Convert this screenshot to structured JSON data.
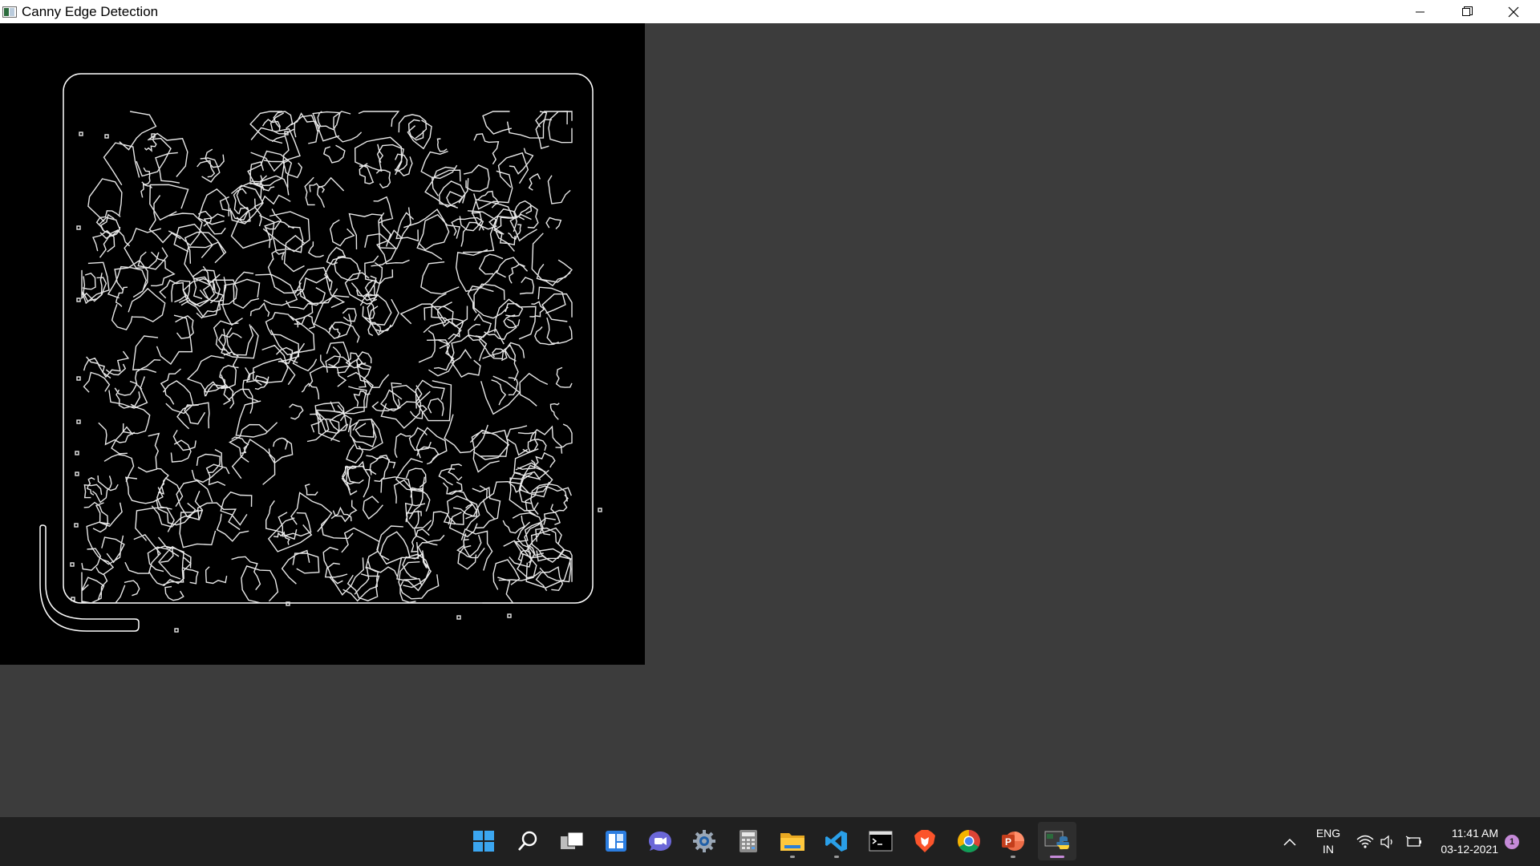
{
  "window": {
    "title": "Canny Edge Detection",
    "controls": {
      "minimize": "minimize-icon",
      "restore": "restore-icon",
      "close": "close-icon"
    }
  },
  "canvas": {
    "background": "#000000",
    "edge_color": "#ffffff"
  },
  "taskbar": {
    "pinned": [
      {
        "name": "start",
        "icon": "windows-start-icon"
      },
      {
        "name": "search",
        "icon": "search-icon"
      },
      {
        "name": "task-view",
        "icon": "task-view-icon"
      },
      {
        "name": "widgets",
        "icon": "widgets-icon"
      },
      {
        "name": "chat",
        "icon": "chat-icon"
      },
      {
        "name": "settings",
        "icon": "gear-icon"
      },
      {
        "name": "calculator",
        "icon": "calculator-icon"
      },
      {
        "name": "file-explorer",
        "icon": "folder-icon"
      },
      {
        "name": "vscode",
        "icon": "vscode-icon"
      },
      {
        "name": "terminal",
        "icon": "terminal-icon"
      },
      {
        "name": "brave",
        "icon": "brave-icon"
      },
      {
        "name": "chrome",
        "icon": "chrome-icon"
      },
      {
        "name": "powerpoint",
        "icon": "powerpoint-icon"
      },
      {
        "name": "python",
        "icon": "python-icon"
      }
    ],
    "tray": {
      "language": "ENG",
      "region": "IN",
      "time": "11:41 AM",
      "date": "03-12-2021",
      "notification_count": "1"
    }
  },
  "colors": {
    "accent": "#c58ad8",
    "taskbar_bg": "#202020",
    "desktop_bg": "#3c3c3c"
  }
}
